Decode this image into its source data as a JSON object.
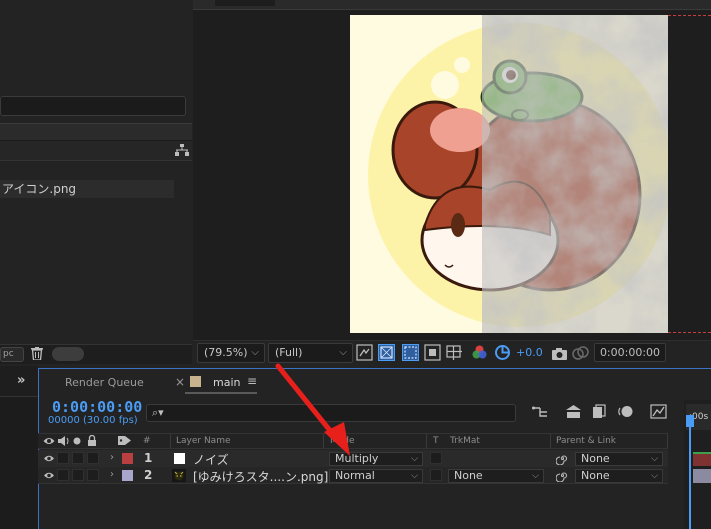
{
  "project": {
    "file_name": "アイコン.png",
    "bpc_label": "pc"
  },
  "viewer": {
    "zoom": "(79.5%)",
    "resolution": "(Full)",
    "exposure": "+0.0",
    "timecode": "0:00:00:00"
  },
  "timeline": {
    "tabs": [
      {
        "label": "Render Queue"
      },
      {
        "label": "main"
      }
    ],
    "close_glyph": "×",
    "menu_glyph": "≡",
    "expand_glyph": "»",
    "current_time": "0:00:00:00",
    "frame_info": "00000 (30.00 fps)",
    "search_glyph": "⌕▾",
    "ruler_label": ":00s",
    "columns": {
      "hash": "#",
      "layer_name": "Layer Name",
      "mode": "Mode",
      "t": "T",
      "trkmat": "TrkMat",
      "parent_link": "Parent & Link"
    },
    "layers": [
      {
        "num": "1",
        "name": "ノイズ",
        "mode": "Multiply",
        "trkmat": "",
        "parent": "None",
        "label_color": "#b84040",
        "swatch": "#ffffff"
      },
      {
        "num": "2",
        "name": "[ゆみけろスタ....ン.png]",
        "mode": "Normal",
        "trkmat": "None",
        "parent": "None",
        "label_color": "#a9a6cc",
        "swatch": "#000000"
      }
    ]
  },
  "colors": {
    "accent_blue": "#4a9cf4",
    "arrow_red": "#e8201c"
  }
}
